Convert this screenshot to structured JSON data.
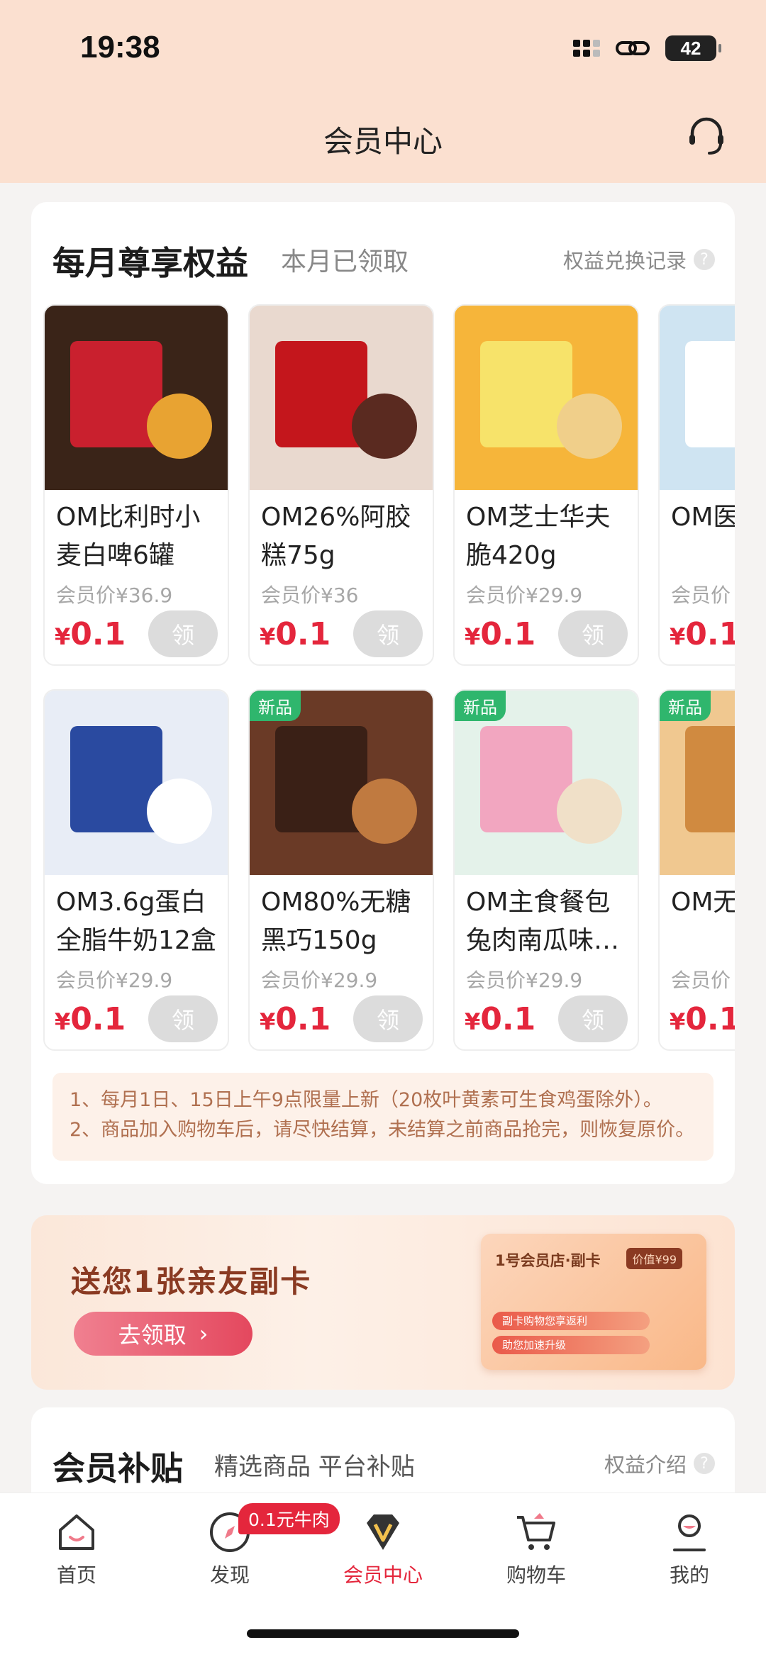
{
  "status_bar": {
    "time": "19:38",
    "battery": "42"
  },
  "header": {
    "title": "会员中心",
    "service_icon": "customer-service-icon"
  },
  "monthly": {
    "title": "每月尊享权益",
    "subtitle": "本月已领取",
    "link": "权益兑换记录",
    "help": "?",
    "row1": [
      {
        "name": "OM比利时小麦白啤6罐",
        "member_price": "会员价¥36.9",
        "currency": "¥",
        "price": "0.1",
        "button": "领",
        "is_new": false
      },
      {
        "name": "OM26%阿胶糕75g",
        "member_price": "会员价¥36",
        "currency": "¥",
        "price": "0.1",
        "button": "领",
        "is_new": false
      },
      {
        "name": "OM芝士华夫脆420g",
        "member_price": "会员价¥29.9",
        "currency": "¥",
        "price": "0.1",
        "button": "领",
        "is_new": false
      },
      {
        "name": "OM医修复喷",
        "member_price": "会员价",
        "currency": "¥",
        "price": "0.1",
        "button": "领",
        "is_new": false
      }
    ],
    "row2": [
      {
        "name": "OM3.6g蛋白全脂牛奶12盒",
        "member_price": "会员价¥29.9",
        "currency": "¥",
        "price": "0.1",
        "button": "领",
        "is_new": false
      },
      {
        "name": "OM80%无糖黑巧150g",
        "member_price": "会员价¥29.9",
        "currency": "¥",
        "price": "0.1",
        "button": "领",
        "is_new": true,
        "tag": "新品"
      },
      {
        "name": "OM主食餐包兔肉南瓜味…",
        "member_price": "会员价¥29.9",
        "currency": "¥",
        "price": "0.1",
        "button": "领",
        "is_new": true,
        "tag": "新品"
      },
      {
        "name": "OM无麦吐司",
        "member_price": "会员价",
        "currency": "¥",
        "price": "0.1",
        "button": "领",
        "is_new": true,
        "tag": "新品"
      }
    ],
    "notice": [
      "1、每月1日、15日上午9点限量上新（20枚叶黄素可生食鸡蛋除外）。",
      "2、商品加入购物车后，请尽快结算，未结算之前商品抢完，则恢复原价。"
    ]
  },
  "banner": {
    "title": "送您1张亲友副卡",
    "button": "去领取",
    "card_title": "1号会员店·副卡",
    "card_badge": "价值¥99",
    "card_line1": "副卡购物您享返利",
    "card_line2": "助您加速升级"
  },
  "subsidy": {
    "title": "会员补贴",
    "subtitle": "精选商品 平台补贴",
    "link": "权益介绍",
    "help": "?"
  },
  "tabbar": {
    "items": [
      {
        "label": "首页",
        "icon": "home-icon"
      },
      {
        "label": "发现",
        "icon": "discover-icon",
        "badge": "0.1元牛肉"
      },
      {
        "label": "会员中心",
        "icon": "vip-icon"
      },
      {
        "label": "购物车",
        "icon": "cart-icon"
      },
      {
        "label": "我的",
        "icon": "profile-icon"
      }
    ]
  },
  "colors": {
    "accent": "#e4263c",
    "header_bg": "#fbe0d0",
    "new_tag": "#2fb66d"
  }
}
